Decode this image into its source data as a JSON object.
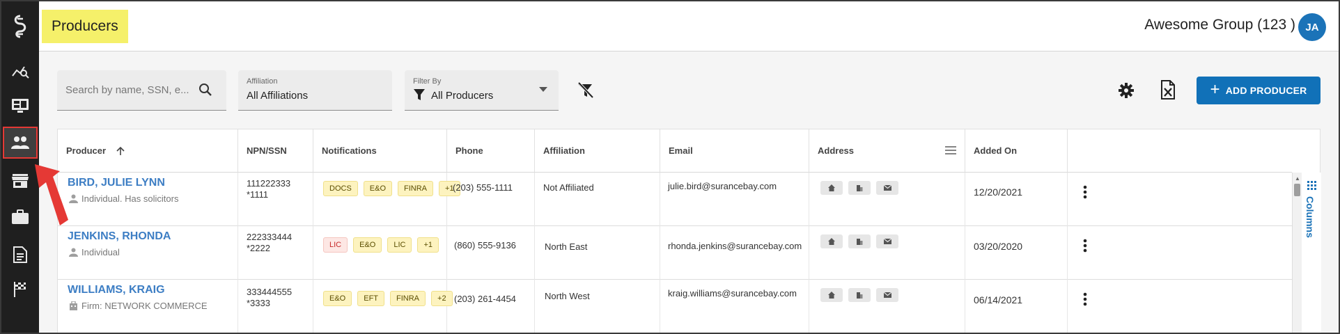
{
  "header": {
    "title": "Producers",
    "org_name": "Awesome Group (123 )",
    "avatar_initials": "JA"
  },
  "sidebar": {
    "items": [
      {
        "icon": "app-logo-icon"
      },
      {
        "icon": "analytics-icon"
      },
      {
        "icon": "dashboard-icon"
      },
      {
        "icon": "people-icon",
        "active": true
      },
      {
        "icon": "store-icon"
      },
      {
        "icon": "briefcase-icon"
      },
      {
        "icon": "document-icon"
      },
      {
        "icon": "flag-icon"
      }
    ]
  },
  "toolbar": {
    "search_placeholder": "Search by name, SSN, e...",
    "affiliation_label": "Affiliation",
    "affiliation_value": "All Affiliations",
    "filter_label": "Filter By",
    "filter_value": "All Producers",
    "add_button": "ADD PRODUCER"
  },
  "table": {
    "columns": [
      "Producer",
      "NPN/SSN",
      "Notifications",
      "Phone",
      "Affiliation",
      "Email",
      "Address",
      "Added On"
    ],
    "columns_toggle": "Columns",
    "rows": [
      {
        "name": "BIRD, JULIE LYNN",
        "type": "Individual. Has solicitors",
        "type_icon": "person-icon",
        "npn": "111222333",
        "ssn": "*1111",
        "notifications": [
          {
            "label": "DOCS",
            "tone": "yellow"
          },
          {
            "label": "E&O",
            "tone": "yellow"
          },
          {
            "label": "FINRA",
            "tone": "yellow"
          },
          {
            "label": "+1",
            "tone": "yellow"
          }
        ],
        "phone": "(203) 555-1111",
        "affiliation": "Not Affiliated",
        "email": "julie.bird@surancebay.com",
        "added_on": "12/20/2021"
      },
      {
        "name": "JENKINS, RHONDA",
        "type": "Individual",
        "type_icon": "person-icon",
        "npn": "222333444",
        "ssn": "*2222",
        "notifications": [
          {
            "label": "LIC",
            "tone": "red"
          },
          {
            "label": "E&O",
            "tone": "yellow"
          },
          {
            "label": "LIC",
            "tone": "yellow"
          },
          {
            "label": "+1",
            "tone": "yellow"
          }
        ],
        "phone": "(860) 555-9136",
        "affiliation": "North East",
        "email": "rhonda.jenkins@surancebay.com",
        "added_on": "03/20/2020"
      },
      {
        "name": "WILLIAMS, KRAIG",
        "type": "Firm: NETWORK COMMERCE",
        "type_icon": "firm-icon",
        "npn": "333444555",
        "ssn": "*3333",
        "notifications": [
          {
            "label": "E&O",
            "tone": "yellow"
          },
          {
            "label": "EFT",
            "tone": "yellow"
          },
          {
            "label": "FINRA",
            "tone": "yellow"
          },
          {
            "label": "+2",
            "tone": "yellow"
          }
        ],
        "phone": "(203) 261-4454",
        "affiliation": "North West",
        "email": "kraig.williams@surancebay.com",
        "added_on": "06/14/2021"
      }
    ]
  },
  "colors": {
    "primary": "#1171b8",
    "link": "#3d7ec4",
    "highlight": "#f5f06a",
    "sidebar": "#1f1f1f",
    "annotation": "#e53935"
  }
}
